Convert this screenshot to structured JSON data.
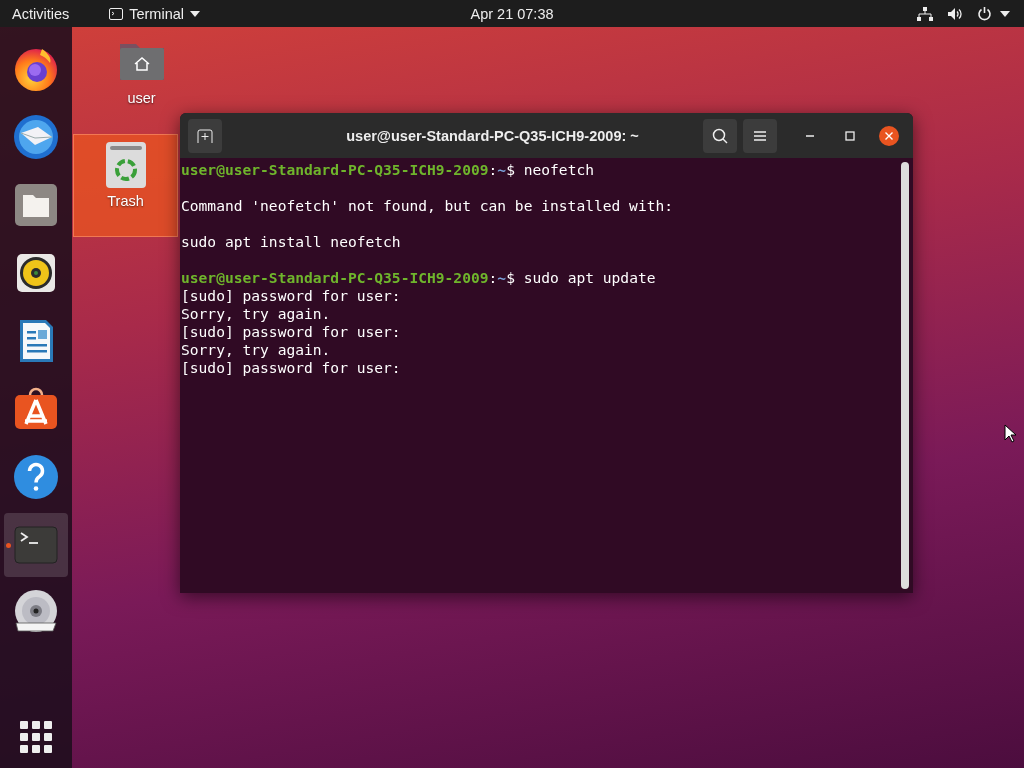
{
  "top_bar": {
    "activities": "Activities",
    "app_menu": "Terminal",
    "clock": "Apr 21  07:38"
  },
  "dock": {
    "items": [
      {
        "selected": false,
        "running": false
      },
      {
        "selected": false,
        "running": false
      },
      {
        "selected": false,
        "running": false
      },
      {
        "selected": false,
        "running": false
      },
      {
        "selected": false,
        "running": false
      },
      {
        "selected": false,
        "running": false
      },
      {
        "selected": false,
        "running": false
      },
      {
        "selected": true,
        "running": true
      },
      {
        "selected": false,
        "running": false
      }
    ]
  },
  "desktop_icons": [
    {
      "label": "user",
      "selected": false
    },
    {
      "label": "Trash",
      "selected": true
    }
  ],
  "terminal": {
    "title": "user@user-Standard-PC-Q35-ICH9-2009: ~",
    "lines": [
      {
        "kind": "prompt",
        "user_host": "user@user-Standard-PC-Q35-ICH9-2009",
        "separator": ":",
        "path": "~",
        "command": "$ neofetch"
      },
      {
        "kind": "blank"
      },
      {
        "kind": "output",
        "text": "Command 'neofetch' not found, but can be installed with:"
      },
      {
        "kind": "blank"
      },
      {
        "kind": "output",
        "text": "sudo apt install neofetch"
      },
      {
        "kind": "blank"
      },
      {
        "kind": "prompt",
        "user_host": "user@user-Standard-PC-Q35-ICH9-2009",
        "separator": ":",
        "path": "~",
        "command": "$ sudo apt update"
      },
      {
        "kind": "output",
        "text": "[sudo] password for user:"
      },
      {
        "kind": "output",
        "text": "Sorry, try again."
      },
      {
        "kind": "output",
        "text": "[sudo] password for user:"
      },
      {
        "kind": "output",
        "text": "Sorry, try again."
      },
      {
        "kind": "output",
        "text": "[sudo] password for user:"
      }
    ]
  }
}
